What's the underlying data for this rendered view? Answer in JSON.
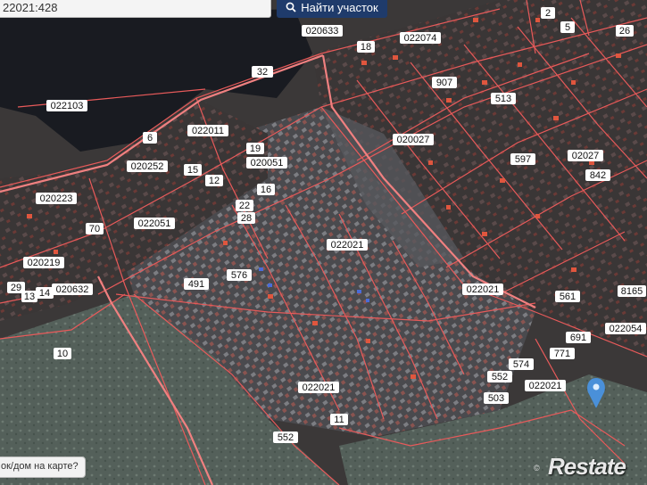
{
  "search": {
    "value": "22021:428",
    "button_label": "Найти участок"
  },
  "hint": {
    "label": "ок/дом на карте?"
  },
  "attribution": "©",
  "watermark": "Restate",
  "colors": {
    "parcel_border": "#e85a5a",
    "search_button": "#1f3b6b",
    "marker": "#4a90d9"
  },
  "map_labels": [
    "020633",
    "022074",
    "022103",
    "02027",
    "020027",
    "022021",
    "020252",
    "020223",
    "022051",
    "020219",
    "020632",
    "022054",
    "020051",
    "022011",
    "907",
    "597",
    "513",
    "32",
    "18",
    "22",
    "26",
    "28",
    "29",
    "14",
    "13",
    "10",
    "70",
    "15",
    "16",
    "19",
    "12",
    "5",
    "6",
    "2",
    "491",
    "552",
    "574",
    "561",
    "503",
    "8165",
    "691",
    "771",
    "576",
    "842",
    "552",
    "11"
  ]
}
